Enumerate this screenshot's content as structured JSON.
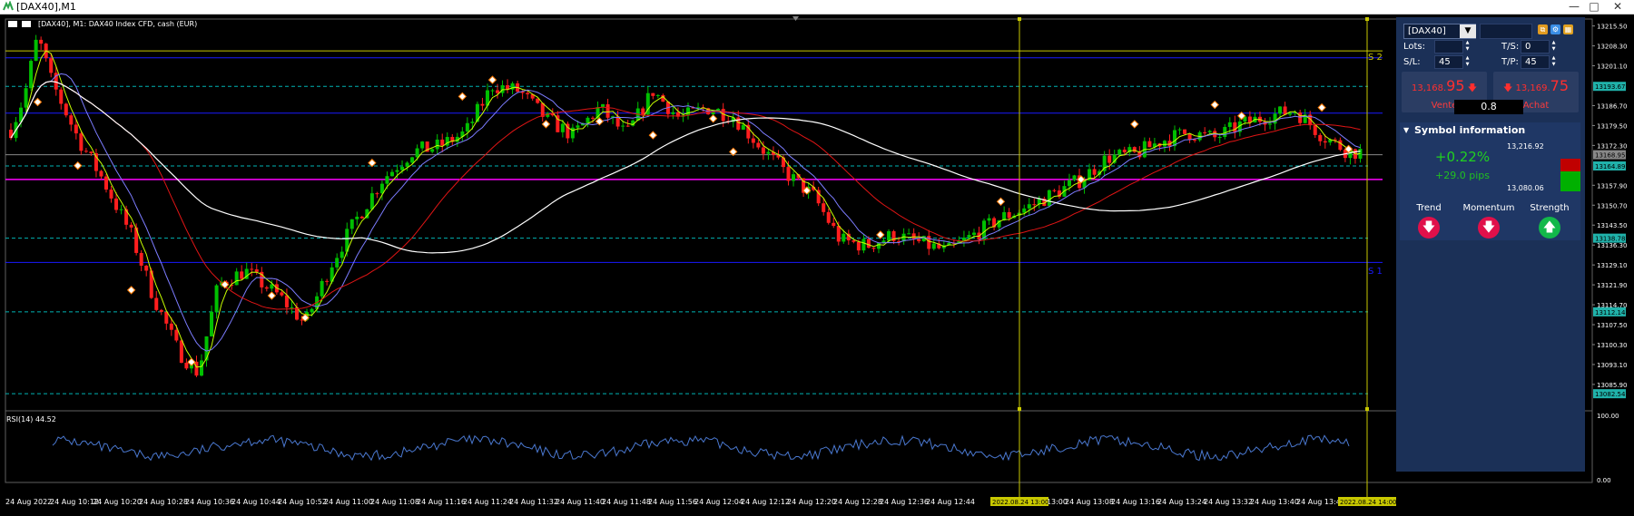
{
  "window": {
    "title": "[DAX40],M1",
    "minimize_glyph": "—",
    "maximize_glyph": "□",
    "close_glyph": "✕"
  },
  "chart": {
    "symbol_label": "[DAX40], M1:  DAX40 Index CFD, cash (EUR)",
    "rsi_label": "RSI(14) 44.52",
    "level_labels": {
      "s2": "S 2",
      "s1": "S 1"
    },
    "price_axis": [
      "13215.50",
      "13208.30",
      "13201.10",
      "13193.67",
      "13186.70",
      "13179.50",
      "13172.30",
      "13168.95",
      "13164.89",
      "13157.90",
      "13150.70",
      "13143.50",
      "13138.78",
      "13136.30",
      "13129.10",
      "13121.90",
      "13114.70",
      "13112.14",
      "13107.50",
      "13100.30",
      "13093.10",
      "13085.90",
      "13082.54"
    ],
    "price_tag_colors": {
      "13193.67": "#20b2aa",
      "13168.95": "#888888",
      "13164.89": "#20b2aa",
      "13138.78": "#20b2aa",
      "13112.14": "#20b2aa",
      "13082.54": "#20b2aa"
    },
    "rsi_axis": [
      "100.00",
      "0.00"
    ],
    "time_axis": [
      "24 Aug 2022",
      "24 Aug 10:12",
      "24 Aug 10:20",
      "24 Aug 10:28",
      "24 Aug 10:36",
      "24 Aug 10:44",
      "24 Aug 10:52",
      "24 Aug 11:00",
      "24 Aug 11:08",
      "24 Aug 11:16",
      "24 Aug 11:24",
      "24 Aug 11:32",
      "24 Aug 11:40",
      "24 Aug 11:48",
      "24 Aug 11:56",
      "24 Aug 12:04",
      "24 Aug 12:12",
      "24 Aug 12:20",
      "24 Aug 12:28",
      "24 Aug 12:36",
      "24 Aug 12:44",
      "24 Aug 13:00",
      "24 Aug 13:08",
      "24 Aug 13:16",
      "24 Aug 13:24",
      "24 Aug 13:32",
      "24 Aug 13:40",
      "24 Aug 13:48"
    ],
    "time_tags": [
      "2022.08.24 13:00",
      "2022.08.24 14:00"
    ],
    "colors": {
      "bull": "#00c000",
      "bear": "#ff1e1e",
      "ma_fast": "#c8ff00",
      "ma_mid": "#7c7cff",
      "ma_slow": "#e01515",
      "ma_long": "#ffffff",
      "pivot": "#00b3b3",
      "magenta": "#ff00ff",
      "blue_level": "#1a1aff",
      "vline": "#c8c800",
      "rsi": "#4a78d0"
    }
  },
  "panel": {
    "symbol": "[DAX40]",
    "lots_label": "Lots:",
    "lots_value": "",
    "ts_label": "T/S:",
    "ts_value": "0",
    "sl_label": "S/L:",
    "sl_value": "45",
    "tp_label": "T/P:",
    "tp_value": "45",
    "sell_price_main": "13,168.",
    "sell_price_big": "95",
    "sell_label": "Vente",
    "buy_price_main": "13,169.",
    "buy_price_big": "75",
    "buy_label": "Achat",
    "spread": "0.8",
    "info_title": "Symbol information",
    "change_pct": "+0.22%",
    "change_pips": "+29.0 pips",
    "high": "13,216.92",
    "low": "13,080.06",
    "trend_label": "Trend",
    "momentum_label": "Momentum",
    "strength_label": "Strength",
    "trend_dir": "down",
    "momentum_dir": "down",
    "strength_dir": "up"
  }
}
